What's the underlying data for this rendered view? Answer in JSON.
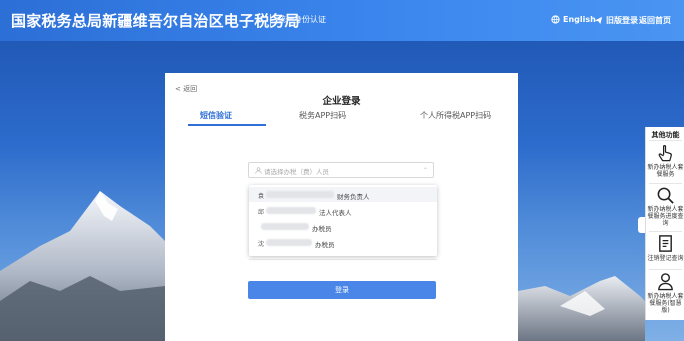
{
  "header": {
    "title": "国家税务总局新疆维吾尔自治区电子税务局",
    "subtitle": "统一身份认证",
    "english": "English",
    "old_login": "旧版登录",
    "home": "返回首页"
  },
  "card": {
    "back": "< 返回",
    "title": "企业登录",
    "tabs": [
      "短信验证",
      "税务APP扫码",
      "个人所得税APP扫码"
    ],
    "select_placeholder": "请选择办税（费）人员",
    "options": [
      {
        "prefix": "袁",
        "suffix": "财务负责人"
      },
      {
        "prefix": "邱",
        "suffix": "法人代表人"
      },
      {
        "prefix": "",
        "suffix": "办税员"
      },
      {
        "prefix": "沈",
        "suffix": "办税员"
      }
    ],
    "login": "登录"
  },
  "side": {
    "title": "其他功能",
    "items": [
      {
        "label": "新办纳税人套餐服务",
        "icon": "hand-pointer-icon"
      },
      {
        "label": "新办纳税人套餐服务进度查询",
        "icon": "search-icon"
      },
      {
        "label": "注销登记查询",
        "icon": "document-icon"
      },
      {
        "label": "新办纳税人套餐服务(智慧版)",
        "icon": "user-icon"
      }
    ]
  },
  "colors": {
    "header": "#2f74dc",
    "accent": "#4a86e8",
    "active_tab": "#2f6fd6"
  }
}
